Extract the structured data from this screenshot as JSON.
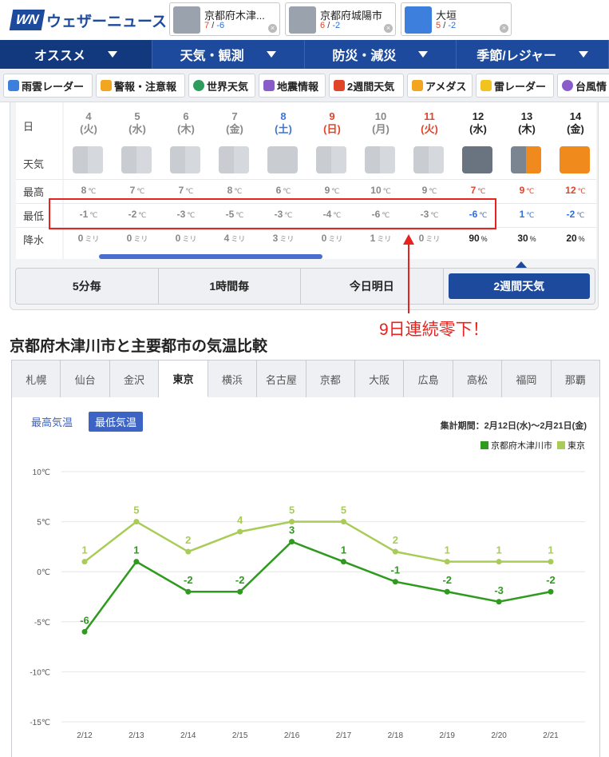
{
  "header": {
    "logo_mark": "WN",
    "logo_text": "ウェザーニュース",
    "locations": [
      {
        "name": "京都府木津...",
        "hi": "7",
        "lo": "-6",
        "icon": "rain-cloud-icon"
      },
      {
        "name": "京都府城陽市",
        "hi": "6",
        "lo": "-2",
        "icon": "rain-cloud-icon"
      },
      {
        "name": "大垣",
        "hi": "5",
        "lo": "-2",
        "icon": "snow-cloud-icon"
      }
    ],
    "sep": "/",
    "close_glyph": "×"
  },
  "nav": {
    "items": [
      "オススメ",
      "天気・観測",
      "防災・減災",
      "季節/レジャー"
    ]
  },
  "subnav": {
    "items": [
      {
        "label": "雨雲レーダー",
        "color": "#3d7fdc"
      },
      {
        "label": "警報・注意報",
        "color": "#f2a51f"
      },
      {
        "label": "世界天気",
        "color": "#2e9c5c"
      },
      {
        "label": "地震情報",
        "color": "#8a5cc9"
      },
      {
        "label": "2週間天気",
        "color": "#e0452a"
      },
      {
        "label": "アメダス",
        "color": "#f2a51f"
      },
      {
        "label": "雷レーダー",
        "color": "#f2c21f"
      },
      {
        "label": "台風情",
        "color": "#8a5cc9"
      }
    ]
  },
  "forecast": {
    "row_labels": [
      "日",
      "天気",
      "最高",
      "最低",
      "降水"
    ],
    "temp_unit": "℃",
    "days": [
      {
        "day": "4",
        "dow": "(火)",
        "hi": "8",
        "lo": "-1",
        "precip": "0",
        "punit": "ミリ",
        "kind": "past",
        "icon": "sun-cloud-icon"
      },
      {
        "day": "5",
        "dow": "(水)",
        "hi": "7",
        "lo": "-2",
        "precip": "0",
        "punit": "ミリ",
        "kind": "past",
        "icon": "sun-cloud-icon"
      },
      {
        "day": "6",
        "dow": "(木)",
        "hi": "7",
        "lo": "-3",
        "precip": "0",
        "punit": "ミリ",
        "kind": "past",
        "icon": "sun-cloud-icon"
      },
      {
        "day": "7",
        "dow": "(金)",
        "hi": "8",
        "lo": "-5",
        "precip": "4",
        "punit": "ミリ",
        "kind": "past",
        "icon": "sun-cloud-icon"
      },
      {
        "day": "8",
        "dow": "(土)",
        "hi": "6",
        "lo": "-3",
        "precip": "3",
        "punit": "ミリ",
        "kind": "past-sat",
        "icon": "cloud-icon"
      },
      {
        "day": "9",
        "dow": "(日)",
        "hi": "9",
        "lo": "-4",
        "precip": "0",
        "punit": "ミリ",
        "kind": "past-sun",
        "icon": "sun-cloud-icon"
      },
      {
        "day": "10",
        "dow": "(月)",
        "hi": "10",
        "lo": "-6",
        "precip": "1",
        "punit": "ミリ",
        "kind": "past",
        "icon": "sun-cloud-icon"
      },
      {
        "day": "11",
        "dow": "(火)",
        "hi": "9",
        "lo": "-3",
        "precip": "0",
        "punit": "ミリ",
        "kind": "past-hol",
        "icon": "sun-cloud-icon"
      },
      {
        "day": "12",
        "dow": "(水)",
        "hi": "7",
        "lo": "-6",
        "precip": "90",
        "punit": "%",
        "kind": "now",
        "icon": "rain-cloud-icon"
      },
      {
        "day": "13",
        "dow": "(木)",
        "hi": "9",
        "lo": "1",
        "precip": "30",
        "punit": "%",
        "kind": "future",
        "icon": "cloud-sun-icon"
      },
      {
        "day": "14",
        "dow": "(金)",
        "hi": "12",
        "lo": "-2",
        "precip": "20",
        "punit": "%",
        "kind": "future",
        "icon": "sun-icon"
      }
    ]
  },
  "view_tabs": [
    "5分毎",
    "1時間毎",
    "今日明日",
    "2週間天気"
  ],
  "annotation": "9日連続零下！",
  "comparison": {
    "title": "京都府木津川市と主要都市の気温比較",
    "cities": [
      "札幌",
      "仙台",
      "金沢",
      "東京",
      "横浜",
      "名古屋",
      "京都",
      "大阪",
      "広島",
      "高松",
      "福岡",
      "那覇"
    ],
    "active_city": "東京",
    "toggle_max": "最高気温",
    "toggle_min": "最低気温",
    "period": "集計期間：2月12日(水)〜2月21日(金)"
  },
  "chart_data": {
    "type": "line",
    "x": [
      "2/12",
      "2/13",
      "2/14",
      "2/15",
      "2/16",
      "2/17",
      "2/18",
      "2/19",
      "2/20",
      "2/21"
    ],
    "yticks": [
      "10℃",
      "5℃",
      "0℃",
      "-5℃",
      "-10℃",
      "-15℃"
    ],
    "ylim": [
      -15,
      10
    ],
    "legend": "top-right",
    "grid": true,
    "series": [
      {
        "name": "京都府木津川市",
        "color": "#2e9a1e",
        "values": [
          -6,
          1,
          -2,
          -2,
          3,
          1,
          -1,
          -2,
          -3,
          -2
        ]
      },
      {
        "name": "東京",
        "color": "#a8cc55",
        "values": [
          1,
          5,
          2,
          4,
          5,
          5,
          2,
          1,
          1,
          1
        ]
      }
    ]
  },
  "colors": {
    "brand": "#1d4a9c",
    "highlight_red": "#e8221e"
  }
}
